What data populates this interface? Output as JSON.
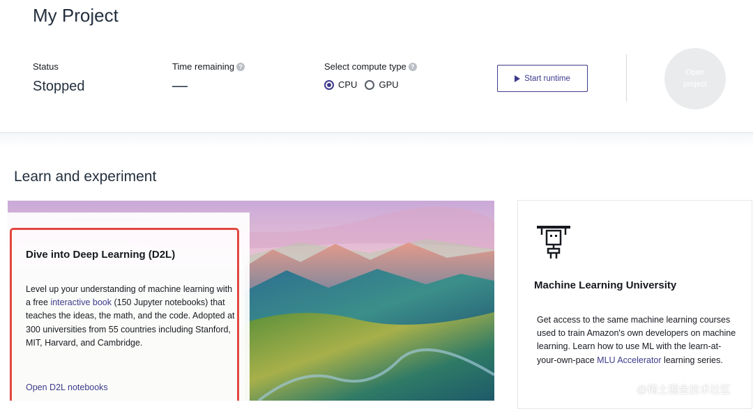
{
  "project": {
    "title": "My Project",
    "status_label": "Status",
    "status_value": "Stopped",
    "time_label": "Time remaining",
    "time_value": "—",
    "compute_label": "Select compute type",
    "compute_options": [
      {
        "label": "CPU",
        "selected": true
      },
      {
        "label": "GPU",
        "selected": false
      }
    ],
    "start_button": "Start runtime",
    "open_project": "Open project"
  },
  "learn": {
    "section_title": "Learn and experiment",
    "d2l": {
      "title": "Dive into Deep Learning (D2L)",
      "desc_before": "Level up your understanding of machine learning with a free ",
      "desc_link": "interactive book",
      "desc_after": " (150 Jupyter notebooks) that teaches the ideas, the math, and the code. Adopted at 300 universities from 55 countries including Stanford, MIT, Harvard, and Cambridge.",
      "link": "Open D2L notebooks"
    },
    "mlu": {
      "title": "Machine Learning University",
      "desc_before": "Get access to the same machine learning courses used to train Amazon's own developers on machine learning. Learn how to use ML with the learn-at-your-own-pace ",
      "desc_link": "MLU Accelerator",
      "desc_after": " learning series."
    }
  },
  "watermark": "@稀土掘金技术社区",
  "colors": {
    "accent": "#3d3a8c",
    "highlight_border": "#e2473f",
    "title_text": "#232f3e"
  },
  "icons": [
    "help-icon",
    "play-icon",
    "robot-icon"
  ]
}
